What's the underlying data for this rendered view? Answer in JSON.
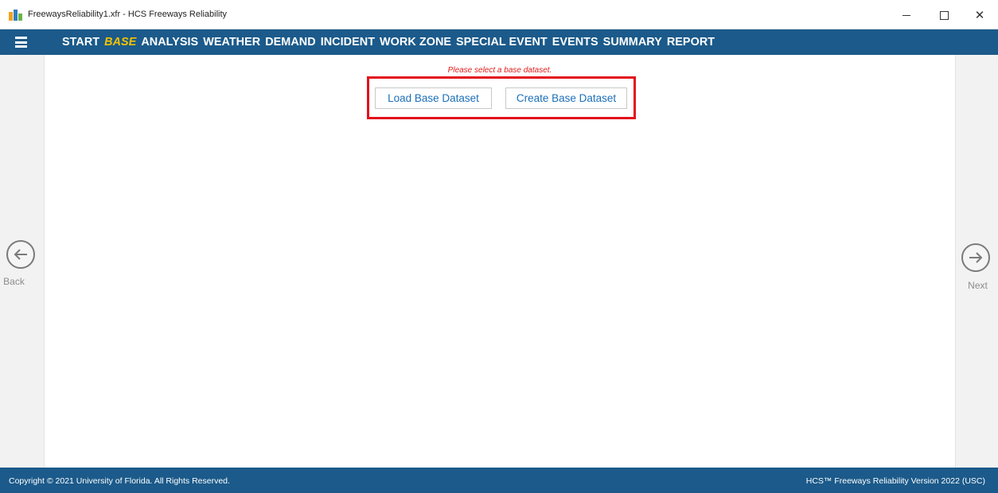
{
  "window": {
    "title": "FreewaysReliability1.xfr - HCS Freeways Reliability",
    "minimize_glyph": "",
    "maximize_glyph": "",
    "close_glyph": "✕"
  },
  "nav": {
    "menu_icon": "hamburger-menu-icon",
    "items": [
      {
        "label": "START",
        "active": false
      },
      {
        "label": "BASE",
        "active": true
      },
      {
        "label": "ANALYSIS",
        "active": false
      },
      {
        "label": "WEATHER",
        "active": false
      },
      {
        "label": "DEMAND",
        "active": false
      },
      {
        "label": "INCIDENT",
        "active": false
      },
      {
        "label": "WORK ZONE",
        "active": false
      },
      {
        "label": "SPECIAL EVENT",
        "active": false
      },
      {
        "label": "EVENTS",
        "active": false
      },
      {
        "label": "SUMMARY",
        "active": false
      },
      {
        "label": "REPORT",
        "active": false
      }
    ]
  },
  "main": {
    "hint": "Please select a base dataset.",
    "load_button": "Load Base Dataset",
    "create_button": "Create Base Dataset"
  },
  "side_nav": {
    "back_label": "Back",
    "next_label": "Next",
    "back_icon": "arrow-left-circle-icon",
    "next_icon": "arrow-right-circle-icon"
  },
  "footer": {
    "copyright": "Copyright © 2021 University of Florida. All Rights Reserved.",
    "version": "HCS™ Freeways Reliability Version 2022 (USC)"
  },
  "colors": {
    "nav_background": "#1b5a8a",
    "active_nav": "#f2c200",
    "hint_text": "#e21b1b",
    "highlight_border": "#e3101b",
    "button_text": "#1b6fb8"
  }
}
